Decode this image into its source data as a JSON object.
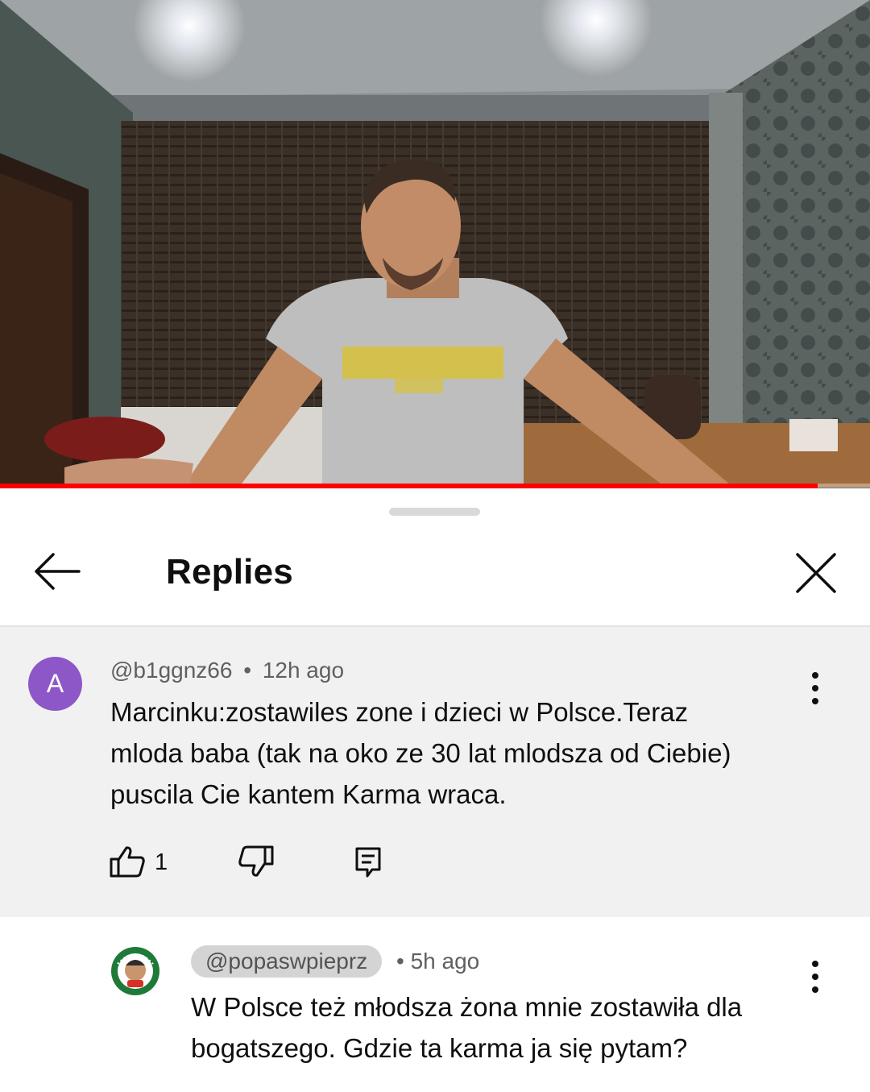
{
  "video": {
    "progress_fraction": 0.94
  },
  "sheet": {
    "title": "Replies"
  },
  "parent_comment": {
    "avatar_letter": "A",
    "avatar_color": "#8e57c8",
    "author": "@b1ggnz66",
    "separator": "•",
    "time": "12h ago",
    "text": "Marcinku:zostawiles zone i dzieci w Polsce.Teraz\nmloda  baba (tak na oko ze 30 lat mlodsza od Ciebie)\npuscila Cie kantem Karma wraca.",
    "like_count": "1",
    "icons": [
      "thumb-up-icon",
      "thumb-down-icon",
      "reply-icon",
      "more-vert-icon"
    ]
  },
  "reply": {
    "author": "@popaswpieprz",
    "separator": "•",
    "time": "5h ago",
    "text": "W Polsce też młodsza żona mnie zostawiła dla\nbogatszego. Gdzie ta karma ja się pytam?",
    "avatar_logo_text": "PO PAS W PIEPRZ"
  },
  "colors": {
    "progress": "#ff0000",
    "parent_bg": "#f1f1f1",
    "handle_badge": "#d4d4d4"
  }
}
